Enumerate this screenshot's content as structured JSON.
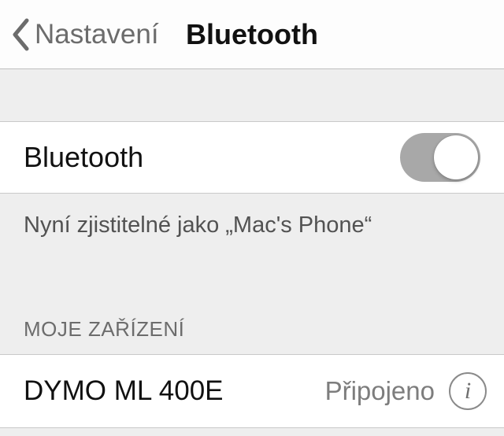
{
  "header": {
    "back_label": "Nastavení",
    "title": "Bluetooth"
  },
  "toggle": {
    "label": "Bluetooth",
    "on": true
  },
  "discoverable_note": "Nyní zjistitelné jako „Mac's Phone“",
  "section_title": "MOJE ZAŘÍZENÍ",
  "devices": [
    {
      "name": "DYMO ML 400E",
      "status": "Připojeno"
    }
  ]
}
